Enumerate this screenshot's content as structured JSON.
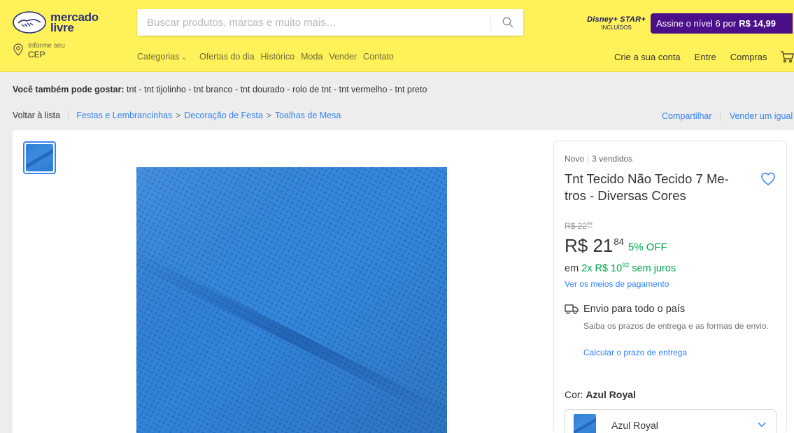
{
  "header": {
    "logo_line1": "mercado",
    "logo_line2": "livre",
    "search_placeholder": "Buscar produtos, marcas e muito mais…",
    "promo_brands": "Disney+ STAR+",
    "promo_included": "INCLUÍDOS",
    "promo_text": "Assine o nível 6 por",
    "promo_price": "R$ 14,99",
    "cep_line1": "Informe seu",
    "cep_line2": "CEP",
    "nav": [
      "Categorias",
      "Ofertas do dia",
      "Histórico",
      "Moda",
      "Vender",
      "Contato"
    ],
    "user_nav": [
      "Crie a sua conta",
      "Entre",
      "Compras"
    ]
  },
  "suggestions": {
    "label": "Você também pode gostar:",
    "items": "tnt - tnt tijolinho - tnt branco - tnt dourado - rolo de tnt - tnt vermelho - tnt preto"
  },
  "breadcrumb": {
    "back": "Voltar à lista",
    "items": [
      "Festas e Lembrancinhas",
      "Decoração de Festa",
      "Toalhas de Mesa"
    ],
    "share": "Compartilhar",
    "sell_similar": "Vender um igual"
  },
  "product": {
    "condition": "Novo",
    "sold": "3 vendidos",
    "title": "Tnt Tecido Não Tecido 7 Me- tros - Diversas Cores",
    "old_price_int": "R$ 22",
    "old_price_cents": "99",
    "price_int": "R$ 21",
    "price_cents": "84",
    "discount": "5% OFF",
    "installments_prefix": "em",
    "installments_value": "2x R$ 10",
    "installments_cents": "92",
    "installments_suffix": "sem juros",
    "payment_link": "Ver os meios de pagamento",
    "shipping_title": "Envio para todo o país",
    "shipping_desc": "Saiba os prazos de entrega e as formas de envio.",
    "shipping_link": "Calcular o prazo de entrega",
    "color_label": "Cor:",
    "color_value": "Azul Royal",
    "color_selected": "Azul Royal"
  },
  "colors": {
    "header_bg": "#fff159",
    "accent_blue": "#3483fa",
    "green": "#00a650",
    "promo_purple": "#4b0f8a",
    "fabric_blue": "#2f7fd6"
  }
}
